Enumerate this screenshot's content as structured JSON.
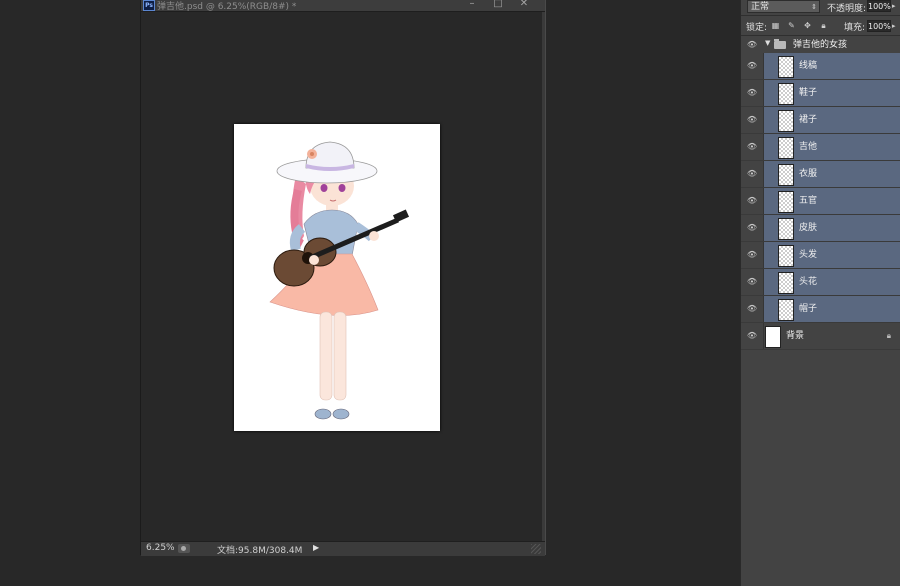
{
  "document_window": {
    "app_badge": "Ps",
    "title": "弹吉他.psd @ 6.25%(RGB/8#) *",
    "minimize": "–",
    "restore": "□",
    "close": "✕"
  },
  "status_bar": {
    "zoom": "6.25%",
    "doc_size": "文档:95.8M/308.4M",
    "arrow": "▶"
  },
  "layers_panel": {
    "blend_mode": "正常",
    "opacity_label": "不透明度:",
    "opacity_value": "100%",
    "lock_label": "锁定:",
    "fill_label": "填充:",
    "fill_value": "100%",
    "group_name": "弹吉他的女孩",
    "layers": [
      {
        "name": "线稿"
      },
      {
        "name": "鞋子"
      },
      {
        "name": "裙子"
      },
      {
        "name": "吉他"
      },
      {
        "name": "衣服"
      },
      {
        "name": "五官"
      },
      {
        "name": "皮肤"
      },
      {
        "name": "头发"
      },
      {
        "name": "头花"
      },
      {
        "name": "帽子"
      }
    ],
    "background_layer": "背景"
  },
  "colors": {
    "selected_layer": "#5a6880",
    "panel_bg": "#434343",
    "workspace_bg": "#282828"
  }
}
